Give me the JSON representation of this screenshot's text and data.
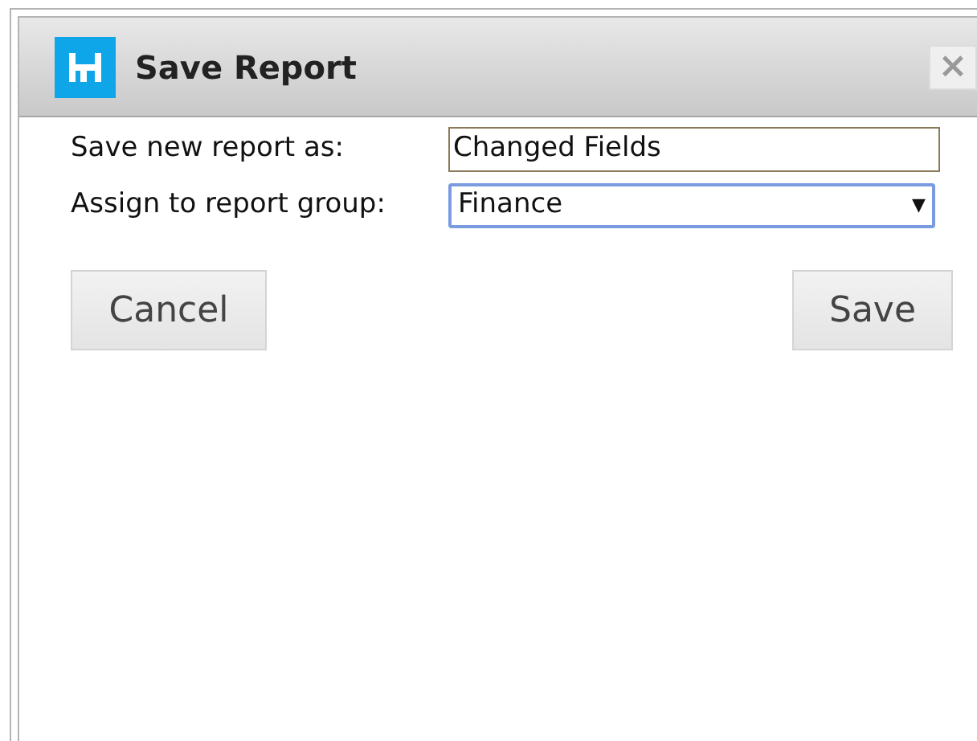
{
  "dialog": {
    "title": "Save Report",
    "close": "×"
  },
  "form": {
    "name_label": "Save new report as:",
    "name_value": "Changed Fields",
    "group_label": "Assign to report group:",
    "group_value": "Finance",
    "group_caret": "▼"
  },
  "buttons": [
    {
      "label": "Cancel",
      "kind": "cancel"
    },
    {
      "label": "Save",
      "kind": "save"
    }
  ]
}
